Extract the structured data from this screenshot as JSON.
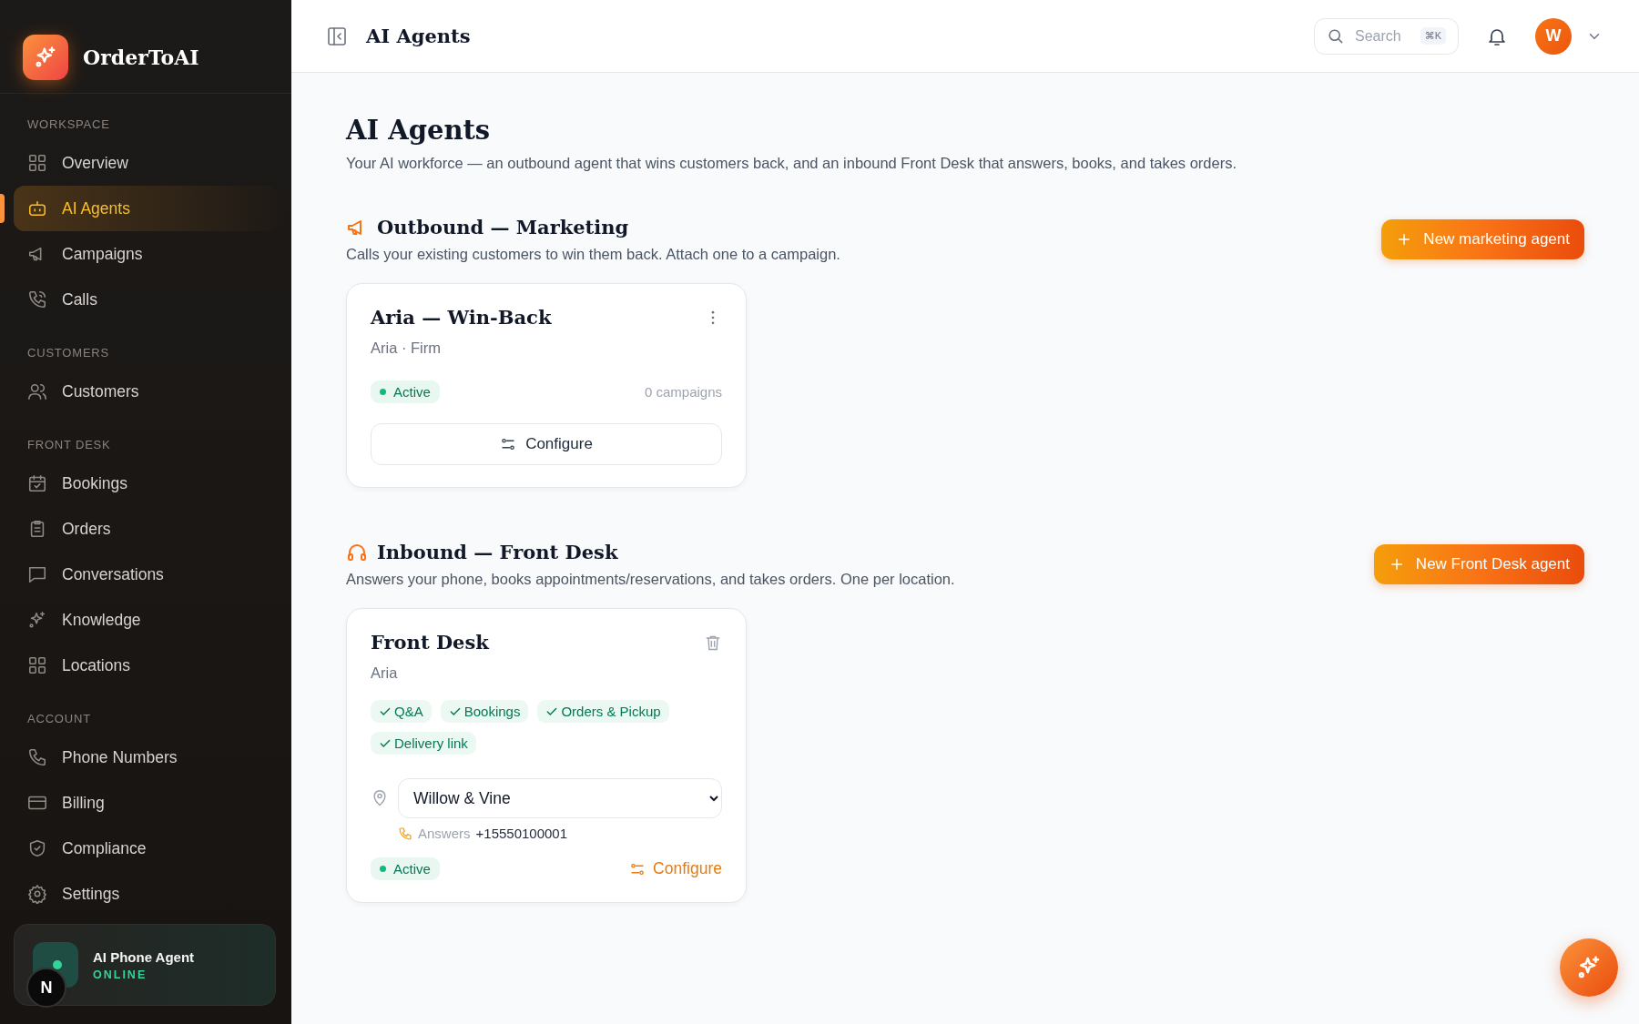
{
  "brand": {
    "name": "OrderToAI"
  },
  "sidebar": {
    "sections": [
      {
        "label": "WORKSPACE",
        "items": [
          {
            "label": "Overview",
            "selected": false
          },
          {
            "label": "AI Agents",
            "selected": true
          },
          {
            "label": "Campaigns",
            "selected": false
          },
          {
            "label": "Calls",
            "selected": false
          }
        ]
      },
      {
        "label": "CUSTOMERS",
        "items": [
          {
            "label": "Customers",
            "selected": false
          }
        ]
      },
      {
        "label": "FRONT DESK",
        "items": [
          {
            "label": "Bookings",
            "selected": false
          },
          {
            "label": "Orders",
            "selected": false
          },
          {
            "label": "Conversations",
            "selected": false
          },
          {
            "label": "Knowledge",
            "selected": false
          },
          {
            "label": "Locations",
            "selected": false
          }
        ]
      },
      {
        "label": "ACCOUNT",
        "items": [
          {
            "label": "Phone Numbers",
            "selected": false
          },
          {
            "label": "Billing",
            "selected": false
          },
          {
            "label": "Compliance",
            "selected": false
          },
          {
            "label": "Settings",
            "selected": false
          }
        ]
      }
    ],
    "status_card": {
      "title": "AI Phone Agent",
      "status": "ONLINE",
      "online": true
    },
    "dev_badge": "N"
  },
  "header": {
    "title": "AI Agents",
    "search": {
      "placeholder": "Search",
      "shortcut": "⌘K"
    },
    "avatar": "W"
  },
  "page": {
    "title": "AI Agents",
    "subtitle": "Your AI workforce — an outbound agent that wins customers back, and an inbound Front Desk that answers, books, and takes orders.",
    "sections": [
      {
        "kind": "outbound",
        "title": "Outbound — Marketing",
        "description": "Calls your existing customers to win them back. Attach one to a campaign.",
        "button": "New marketing agent",
        "agents": [
          {
            "name": "Aria — Win-Back",
            "subtitle": "Aria · Firm",
            "status": "Active",
            "active": true,
            "campaigns": "0 campaigns",
            "configure": "Configure"
          }
        ]
      },
      {
        "kind": "inbound",
        "title": "Inbound — Front Desk",
        "description": "Answers your phone, books appointments/reservations, and takes orders. One per location.",
        "button": "New Front Desk agent",
        "agents": [
          {
            "name": "Front Desk",
            "subtitle": "Aria",
            "capabilities": [
              {
                "label": "Q&A",
                "checked": true
              },
              {
                "label": "Bookings",
                "checked": true
              },
              {
                "label": "Orders & Pickup",
                "checked": true
              },
              {
                "label": "Delivery link",
                "checked": true
              }
            ],
            "location": "Willow & Vine",
            "answers_label": "Answers",
            "phone": "+15550100001",
            "status": "Active",
            "active": true,
            "configure": "Configure"
          }
        ]
      }
    ]
  }
}
